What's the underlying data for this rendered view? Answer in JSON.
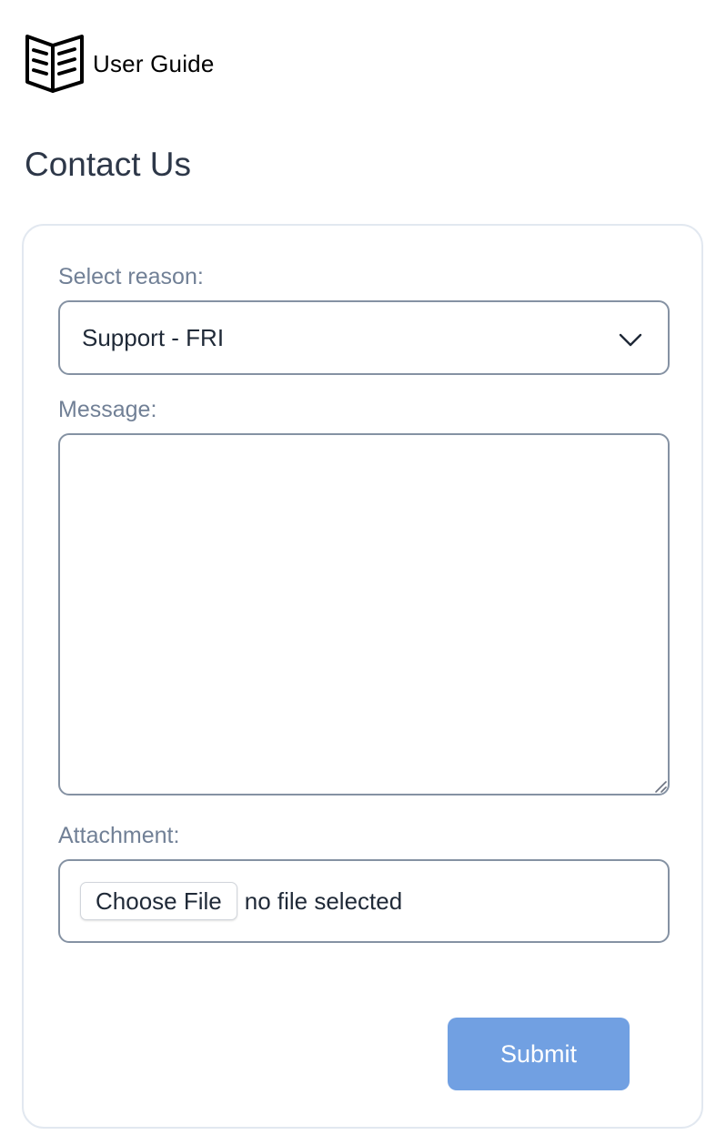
{
  "header": {
    "guide_label": "User Guide",
    "guide_icon": "open-book-icon"
  },
  "page": {
    "title": "Contact Us"
  },
  "form": {
    "reason_label": "Select reason:",
    "reason_value": "Support - FRI",
    "message_label": "Message:",
    "message_value": "",
    "attachment_label": "Attachment:",
    "choose_file_label": "Choose File",
    "file_status": "no file selected",
    "submit_label": "Submit"
  },
  "colors": {
    "submit_bg": "#71a0e2",
    "label_text": "#718096",
    "title_text": "#2d3748",
    "input_border": "#8592a3",
    "card_border": "#e2e8f0"
  }
}
